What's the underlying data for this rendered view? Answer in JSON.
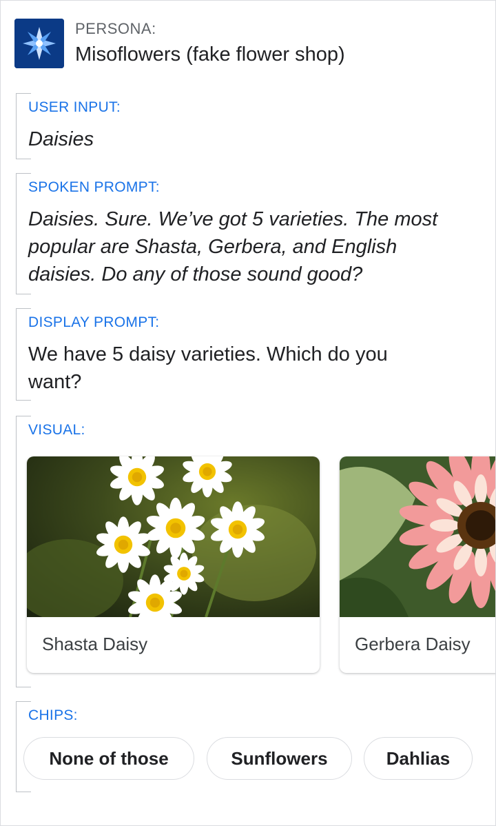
{
  "persona": {
    "label": "PERSONA:",
    "name": "Misoflowers (fake flower shop)",
    "logo_icon": "flower-logo-icon"
  },
  "user_input": {
    "label": "USER INPUT:",
    "text": "Daisies"
  },
  "spoken_prompt": {
    "label": "SPOKEN PROMPT:",
    "lines": [
      "Daisies. Sure. We’ve got 5 varieties. The most",
      "popular are Shasta, Gerbera, and English",
      "daisies. Do any of those sound good?"
    ]
  },
  "display_prompt": {
    "label": "DISPLAY PROMPT:",
    "lines": [
      "We have 5 daisy varieties. Which do you",
      "want?"
    ]
  },
  "visual": {
    "label": "VISUAL:",
    "cards": [
      {
        "title": "Shasta Daisy",
        "image": "shasta-daisy-photo"
      },
      {
        "title": "Gerbera Daisy",
        "image": "gerbera-daisy-photo"
      }
    ]
  },
  "chips": {
    "label": "CHIPS:",
    "items": [
      "None of those",
      "Sunflowers",
      "Dahlias"
    ]
  },
  "colors": {
    "label_blue": "#1a73e8",
    "logo_bg": "#0d3c8a"
  }
}
